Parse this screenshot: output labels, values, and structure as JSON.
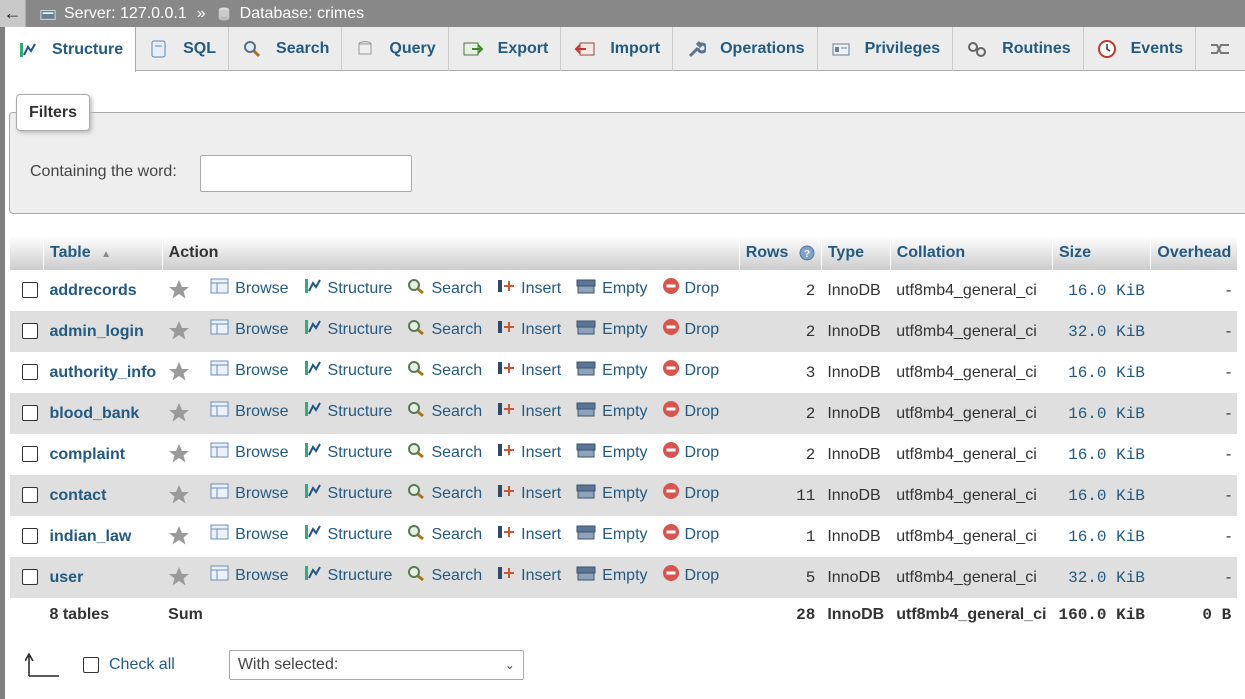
{
  "topbar": {
    "back_label": "←",
    "server": "Server: 127.0.0.1",
    "separator": "»",
    "database": "Database: crimes"
  },
  "tabs": [
    {
      "label": "Structure"
    },
    {
      "label": "SQL"
    },
    {
      "label": "Search"
    },
    {
      "label": "Query"
    },
    {
      "label": "Export"
    },
    {
      "label": "Import"
    },
    {
      "label": "Operations"
    },
    {
      "label": "Privileges"
    },
    {
      "label": "Routines"
    },
    {
      "label": "Events"
    }
  ],
  "filters": {
    "legend": "Filters",
    "label": "Containing the word:",
    "value": ""
  },
  "table": {
    "headers": {
      "table": "Table",
      "action": "Action",
      "rows": "Rows",
      "type": "Type",
      "collation": "Collation",
      "size": "Size",
      "overhead": "Overhead"
    },
    "actions": {
      "browse": "Browse",
      "structure": "Structure",
      "search": "Search",
      "insert": "Insert",
      "empty": "Empty",
      "drop": "Drop"
    },
    "rows": [
      {
        "name": "addrecords",
        "rows": "2",
        "type": "InnoDB",
        "collation": "utf8mb4_general_ci",
        "size": "16.0 KiB",
        "overhead": "-"
      },
      {
        "name": "admin_login",
        "rows": "2",
        "type": "InnoDB",
        "collation": "utf8mb4_general_ci",
        "size": "32.0 KiB",
        "overhead": "-"
      },
      {
        "name": "authority_info",
        "rows": "3",
        "type": "InnoDB",
        "collation": "utf8mb4_general_ci",
        "size": "16.0 KiB",
        "overhead": "-"
      },
      {
        "name": "blood_bank",
        "rows": "2",
        "type": "InnoDB",
        "collation": "utf8mb4_general_ci",
        "size": "16.0 KiB",
        "overhead": "-"
      },
      {
        "name": "complaint",
        "rows": "2",
        "type": "InnoDB",
        "collation": "utf8mb4_general_ci",
        "size": "16.0 KiB",
        "overhead": "-"
      },
      {
        "name": "contact",
        "rows": "11",
        "type": "InnoDB",
        "collation": "utf8mb4_general_ci",
        "size": "16.0 KiB",
        "overhead": "-"
      },
      {
        "name": "indian_law",
        "rows": "1",
        "type": "InnoDB",
        "collation": "utf8mb4_general_ci",
        "size": "16.0 KiB",
        "overhead": "-"
      },
      {
        "name": "user",
        "rows": "5",
        "type": "InnoDB",
        "collation": "utf8mb4_general_ci",
        "size": "32.0 KiB",
        "overhead": "-"
      }
    ],
    "summary": {
      "count": "8 tables",
      "label": "Sum",
      "rows": "28",
      "type": "InnoDB",
      "collation": "utf8mb4_general_ci",
      "size": "160.0 KiB",
      "overhead": "0 B"
    }
  },
  "footer": {
    "check_all": "Check all",
    "with_selected": "With selected:"
  },
  "colors": {
    "link": "#235a81",
    "topbar": "#888888",
    "drop": "#d9534f"
  }
}
